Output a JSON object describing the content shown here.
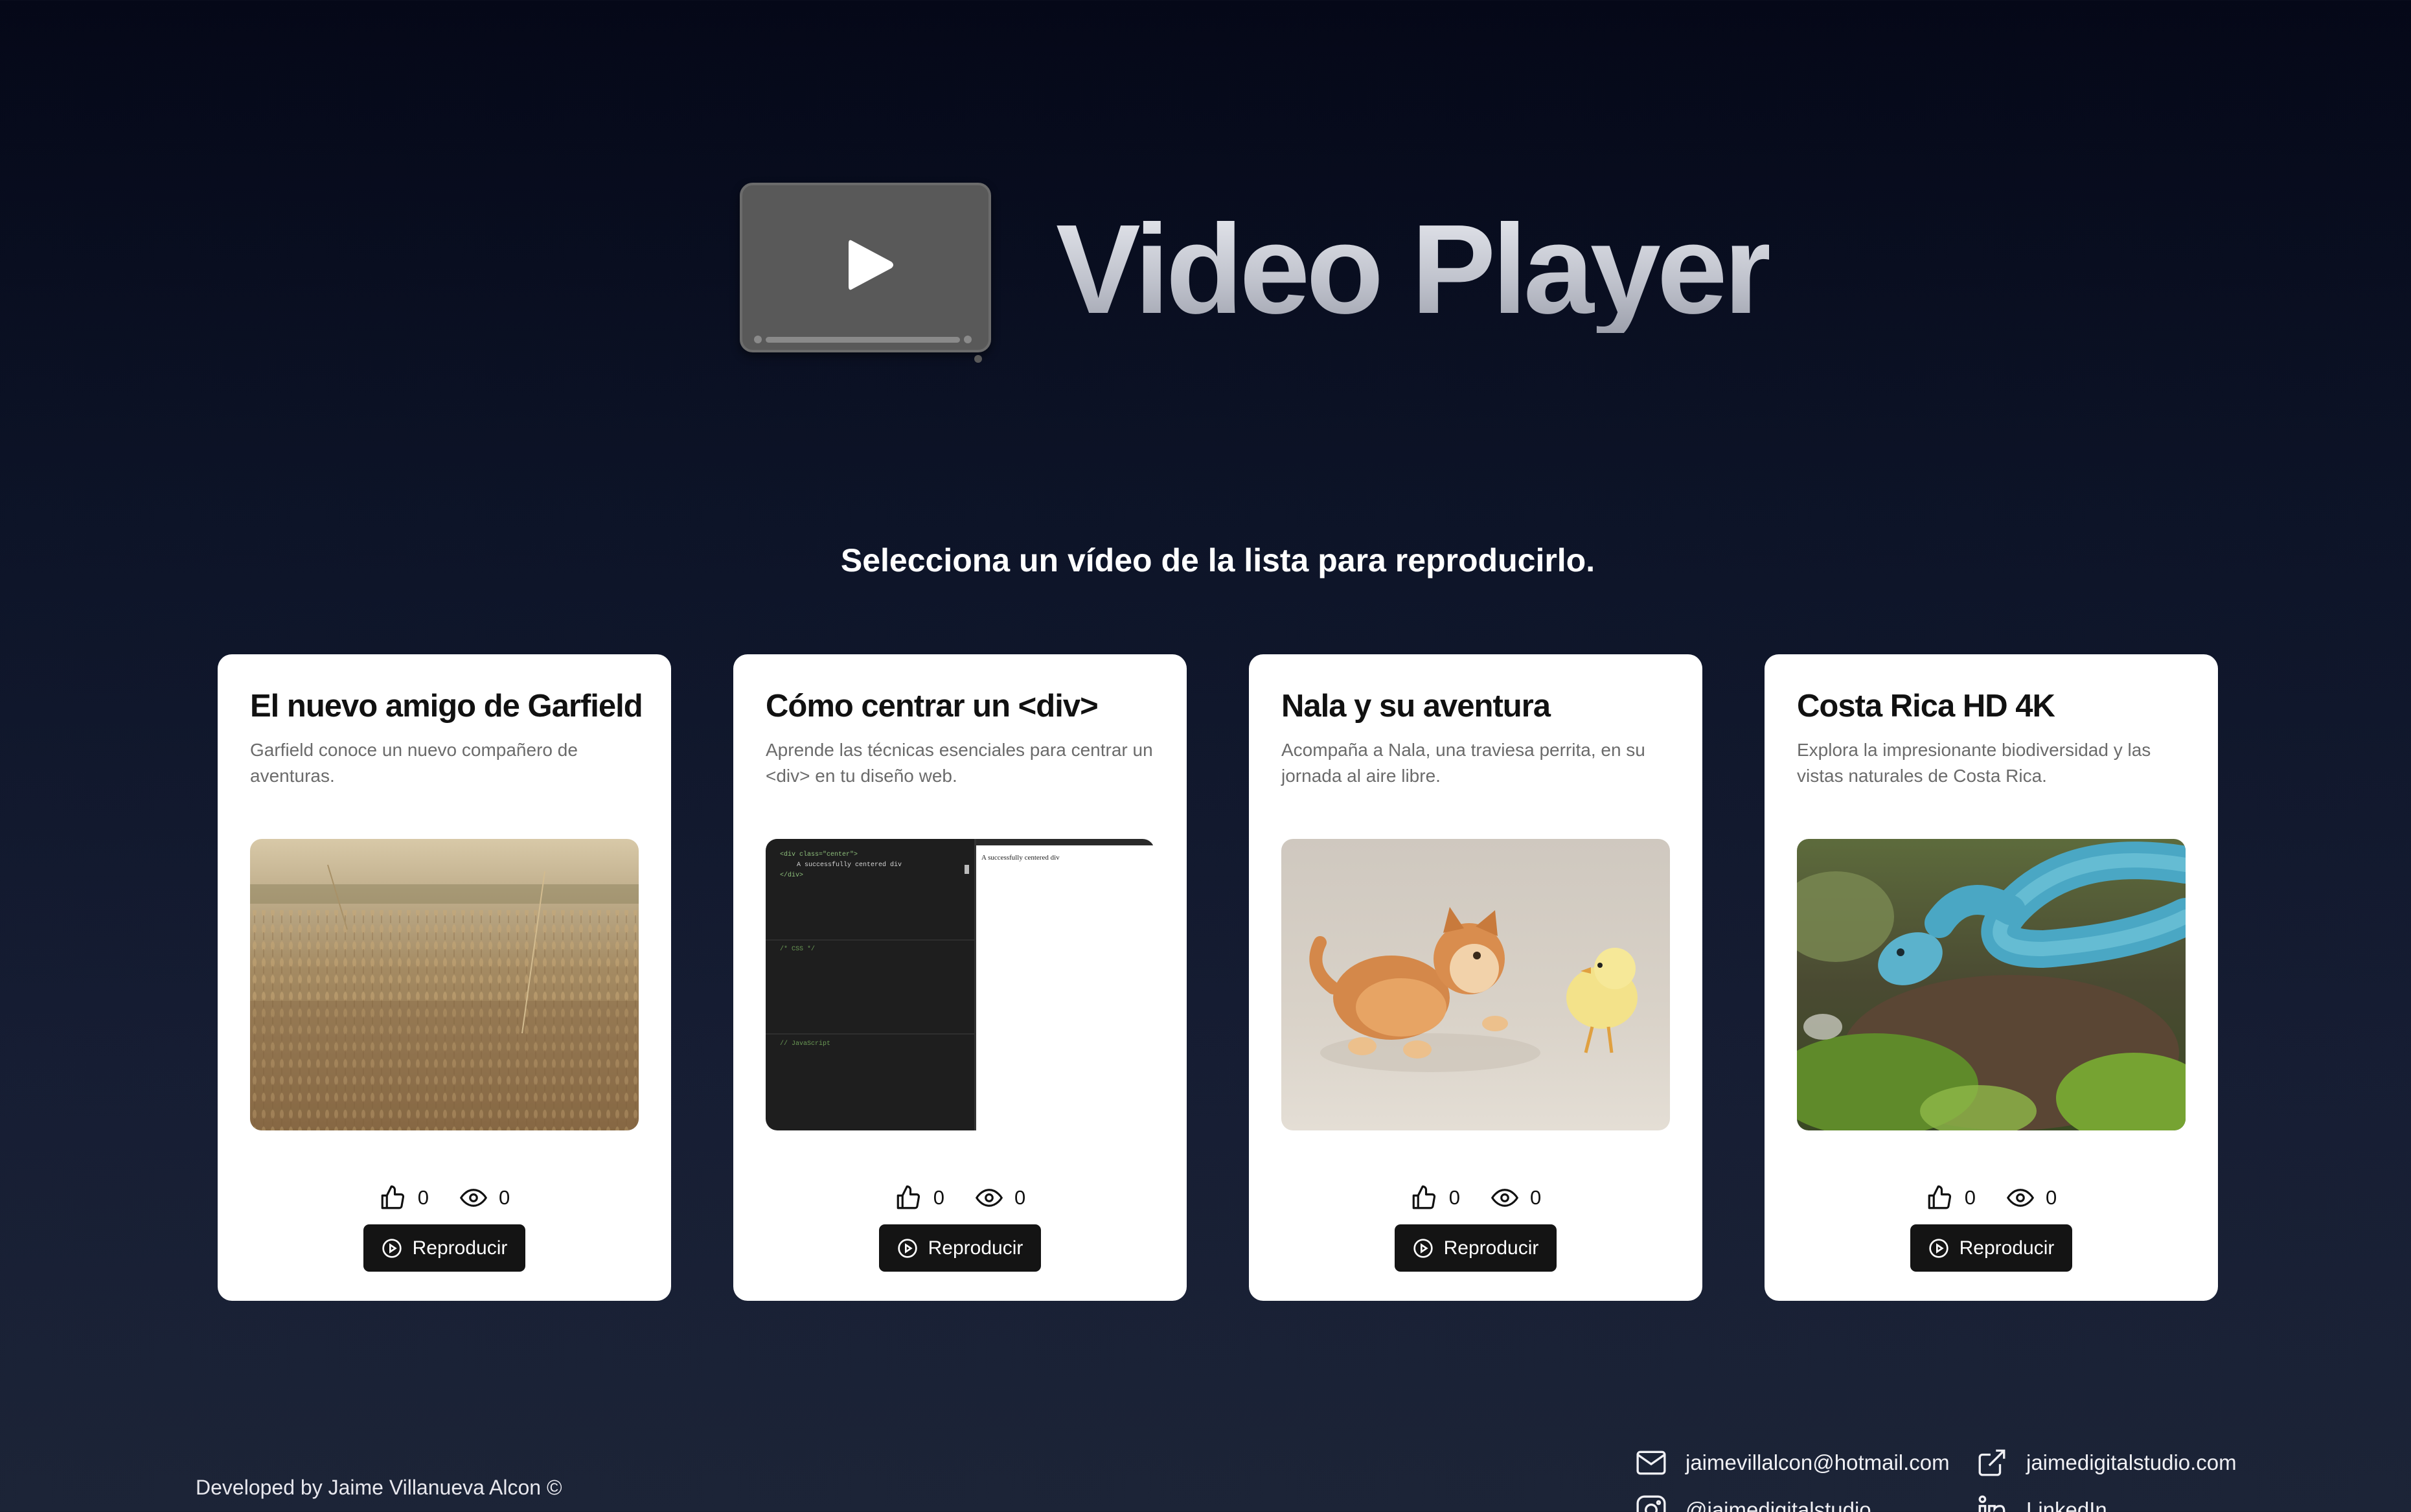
{
  "header": {
    "title": "Video Player",
    "logo_icon": "video-player-logo-icon"
  },
  "subtitle": "Selecciona un vídeo de la lista para reproducirlo.",
  "videos": [
    {
      "title": "El nuevo amigo de Garfield",
      "description": "Garfield conoce un nuevo compañero de aventuras.",
      "thumbnail": "wheat-field",
      "likes": "0",
      "views": "0",
      "button_label": "Reproducir"
    },
    {
      "title": "Cómo centrar un <div>",
      "description": "Aprende las técnicas esenciales para centrar un <div> en tu diseño web.",
      "thumbnail": "code-editor",
      "code_html_line1": "<div class=\"center\">",
      "code_html_line2": "A successfully centered div",
      "code_html_line3": "</div>",
      "code_css": "/* CSS */",
      "code_js": "// JavaScript",
      "preview_text": "A successfully centered div",
      "likes": "0",
      "views": "0",
      "button_label": "Reproducir"
    },
    {
      "title": "Nala y su aventura",
      "description": "Acompaña a Nala, una traviesa perrita, en su jornada al aire libre.",
      "thumbnail": "kitten-and-chick",
      "likes": "0",
      "views": "0",
      "button_label": "Reproducir"
    },
    {
      "title": "Costa Rica HD 4K",
      "description": "Explora la impresionante biodiversidad y las vistas naturales de Costa Rica.",
      "thumbnail": "blue-viper",
      "likes": "0",
      "views": "0",
      "button_label": "Reproducir"
    }
  ],
  "footer": {
    "developer": "Developed by Jaime Villanueva Alcon ©",
    "email": "jaimevillalcon@hotmail.com",
    "website": "jaimedigitalstudio.com",
    "instagram": "@jaimedigitalstudio",
    "linkedin": "LinkedIn"
  }
}
